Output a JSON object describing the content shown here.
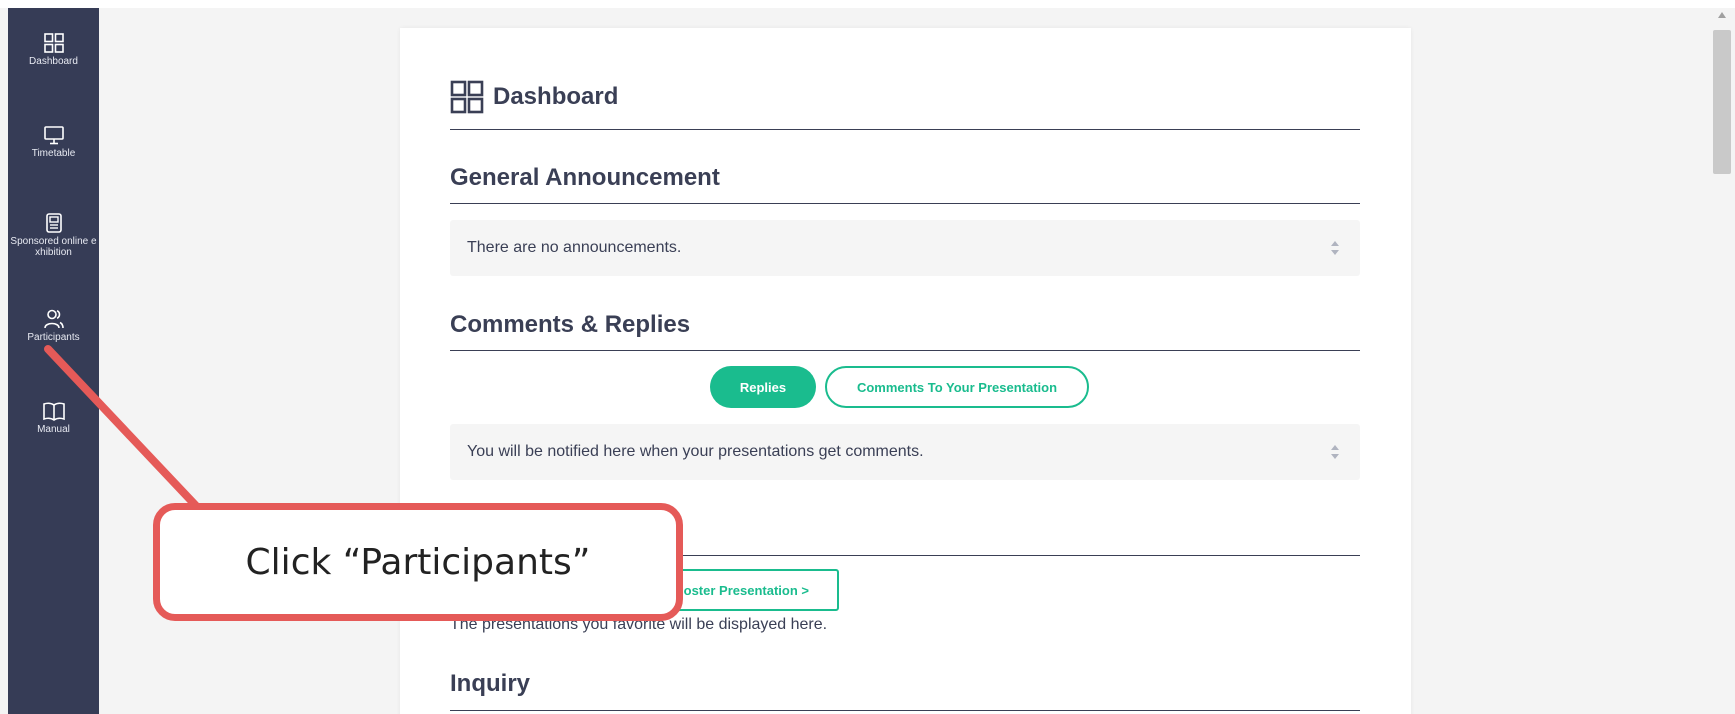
{
  "sidebar": {
    "items": [
      {
        "label": "Dashboard",
        "icon": "grid-icon"
      },
      {
        "label": "Timetable",
        "icon": "monitor-icon"
      },
      {
        "label": "Sponsored online exhibition",
        "icon": "document-icon"
      },
      {
        "label": "Participants",
        "icon": "users-icon"
      },
      {
        "label": "Manual",
        "icon": "book-icon"
      }
    ]
  },
  "main": {
    "title": "Dashboard",
    "announcement": {
      "heading": "General Announcement",
      "text": "There are no announcements."
    },
    "comments": {
      "heading": "Comments & Replies",
      "tabs": [
        "Replies",
        "Comments To Your Presentation"
      ],
      "text": "You will be notified here when your presentations get comments."
    },
    "favorites": {
      "button_label": "oster Presentation >",
      "text": "The presentations you favorite will be displayed here."
    },
    "inquiry": {
      "heading": "Inquiry"
    }
  },
  "callout": {
    "text": "Click “Participants”"
  },
  "colors": {
    "sidebar": "#363c56",
    "accent": "#1abc8e",
    "callout_border": "#e55a58",
    "text": "#3a3f55"
  }
}
